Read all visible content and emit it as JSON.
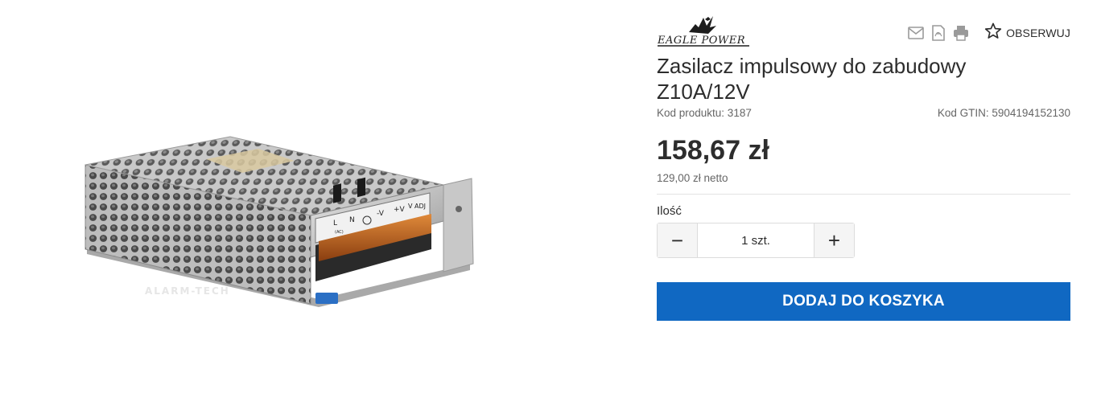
{
  "brand": {
    "logo_text": "EAGLE POWER"
  },
  "actions": {
    "email_icon": "envelope-icon",
    "pdf_icon": "pdf-icon",
    "print_icon": "printer-icon",
    "watch_icon": "star-outline-icon",
    "watch_label": "OBSERWUJ"
  },
  "product": {
    "title": "Zasilacz impulsowy do zabudowy Z10A/12V",
    "code": "Kod produktu: 3187",
    "gtin": "Kod GTIN: 5904194152130",
    "price": "158,67 zł",
    "price_net": "129,00 zł netto",
    "image": {
      "terminal_labels": [
        "L",
        "N",
        "-V",
        "+V",
        "V ADJ"
      ],
      "ac_label": "(AC)",
      "watermark": "ALARM-TECH"
    }
  },
  "quantity": {
    "label": "Ilość",
    "value": "1 szt.",
    "minus": "−",
    "plus": "+"
  },
  "cart": {
    "add_label": "DODAJ DO KOSZYKA"
  },
  "colors": {
    "accent": "#1068c2",
    "text": "#2d2d2d",
    "muted": "#666666"
  }
}
